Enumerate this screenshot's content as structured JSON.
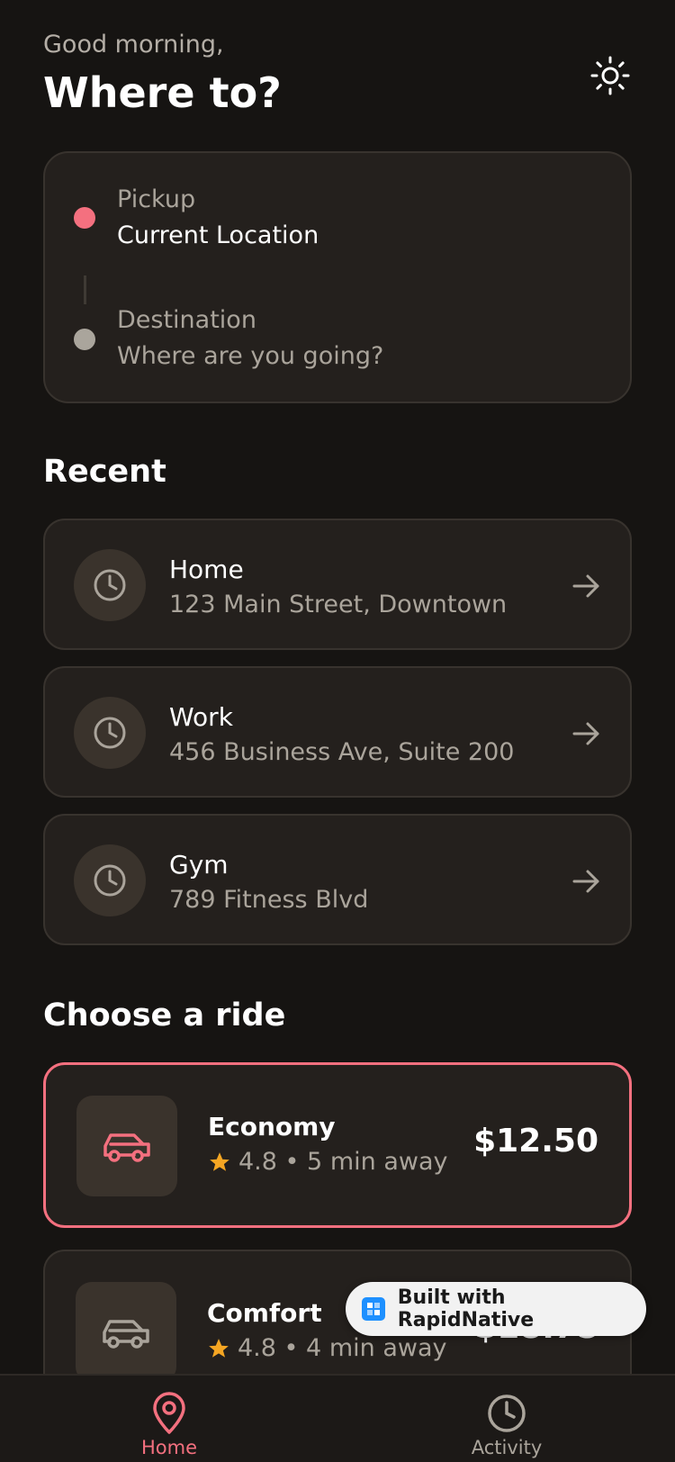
{
  "header": {
    "greeting": "Good morning,",
    "title": "Where to?"
  },
  "route": {
    "pickup_label": "Pickup",
    "pickup_value": "Current Location",
    "destination_label": "Destination",
    "destination_placeholder": "Where are you going?"
  },
  "recent": {
    "title": "Recent",
    "items": [
      {
        "name": "Home",
        "address": "123 Main Street, Downtown"
      },
      {
        "name": "Work",
        "address": "456 Business Ave, Suite 200"
      },
      {
        "name": "Gym",
        "address": "789 Fitness Blvd"
      }
    ]
  },
  "rides": {
    "title": "Choose a ride",
    "options": [
      {
        "name": "Economy",
        "rating": "4.8",
        "eta": "• 5 min away",
        "price": "$12.50",
        "selected": true
      },
      {
        "name": "Comfort",
        "rating": "4.8",
        "eta": "• 4 min away",
        "price": "$18.75",
        "selected": false
      }
    ]
  },
  "badge": {
    "text": "Built with RapidNative"
  },
  "nav": {
    "home": "Home",
    "activity": "Activity"
  },
  "colors": {
    "accent": "#f4707f",
    "background": "#161412",
    "card": "#24201d",
    "star": "#f5a623"
  }
}
